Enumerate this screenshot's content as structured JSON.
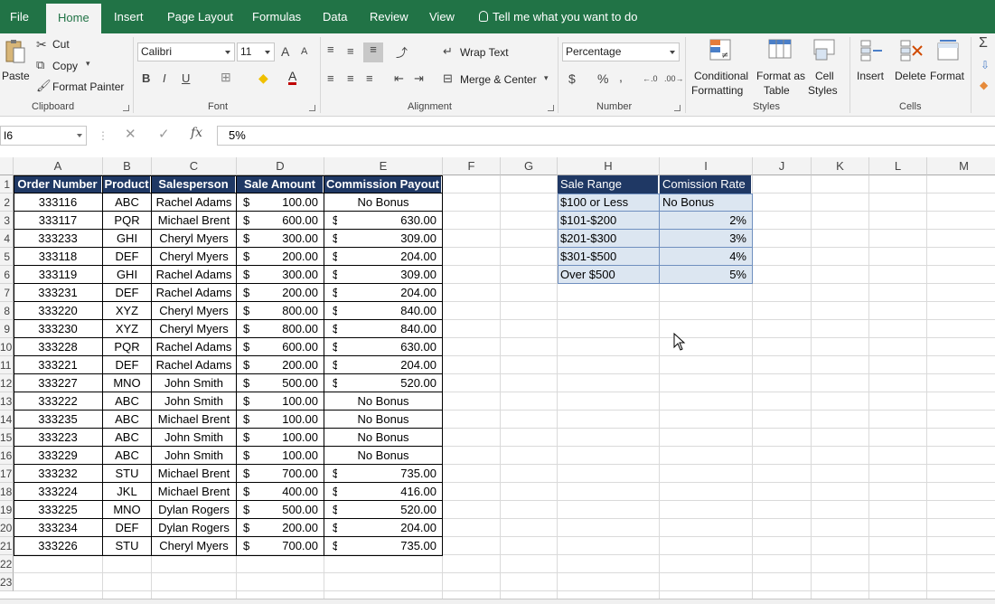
{
  "tabs": [
    {
      "label": "File"
    },
    {
      "label": "Home"
    },
    {
      "label": "Insert"
    },
    {
      "label": "Page Layout"
    },
    {
      "label": "Formulas"
    },
    {
      "label": "Data"
    },
    {
      "label": "Review"
    },
    {
      "label": "View"
    }
  ],
  "tell_me": "Tell me what you want to do",
  "ribbon": {
    "clipboard": {
      "paste": "Paste",
      "cut": "Cut",
      "copy": "Copy",
      "format_painter": "Format Painter",
      "label": "Clipboard"
    },
    "font": {
      "name": "Calibri",
      "size": "11",
      "label": "Font"
    },
    "alignment": {
      "wrap": "Wrap Text",
      "merge": "Merge & Center",
      "label": "Alignment"
    },
    "number": {
      "format": "Percentage",
      "label": "Number"
    },
    "styles": {
      "cond1": "Conditional",
      "cond2": "Formatting",
      "fmt1": "Format as",
      "fmt2": "Table",
      "cell1": "Cell",
      "cell2": "Styles",
      "label": "Styles"
    },
    "cells": {
      "insert": "Insert",
      "delete": "Delete",
      "format": "Format",
      "label": "Cells"
    }
  },
  "formula_bar": {
    "name_box": "I6",
    "formula": "5%"
  },
  "columns": [
    "A",
    "B",
    "C",
    "D",
    "E",
    "F",
    "G",
    "H",
    "I",
    "J",
    "K",
    "L",
    "M"
  ],
  "rows": [
    "1",
    "2",
    "3",
    "4",
    "5",
    "6",
    "7",
    "8",
    "9",
    "10",
    "11",
    "12",
    "13",
    "14",
    "15",
    "16",
    "17",
    "18",
    "19",
    "20",
    "21",
    "22",
    "23"
  ],
  "table_headers": [
    "Order Number",
    "Product",
    "Salesperson",
    "Sale Amount",
    "Commission Payout"
  ],
  "table_rows": [
    [
      "333116",
      "ABC",
      "Rachel Adams",
      "100.00",
      "No Bonus"
    ],
    [
      "333117",
      "PQR",
      "Michael Brent",
      "600.00",
      "630.00"
    ],
    [
      "333233",
      "GHI",
      "Cheryl Myers",
      "300.00",
      "309.00"
    ],
    [
      "333118",
      "DEF",
      "Cheryl Myers",
      "200.00",
      "204.00"
    ],
    [
      "333119",
      "GHI",
      "Rachel Adams",
      "300.00",
      "309.00"
    ],
    [
      "333231",
      "DEF",
      "Rachel Adams",
      "200.00",
      "204.00"
    ],
    [
      "333220",
      "XYZ",
      "Cheryl Myers",
      "800.00",
      "840.00"
    ],
    [
      "333230",
      "XYZ",
      "Cheryl Myers",
      "800.00",
      "840.00"
    ],
    [
      "333228",
      "PQR",
      "Rachel Adams",
      "600.00",
      "630.00"
    ],
    [
      "333221",
      "DEF",
      "Rachel Adams",
      "200.00",
      "204.00"
    ],
    [
      "333227",
      "MNO",
      "John Smith",
      "500.00",
      "520.00"
    ],
    [
      "333222",
      "ABC",
      "John Smith",
      "100.00",
      "No Bonus"
    ],
    [
      "333235",
      "ABC",
      "Michael Brent",
      "100.00",
      "No Bonus"
    ],
    [
      "333223",
      "ABC",
      "John Smith",
      "100.00",
      "No Bonus"
    ],
    [
      "333229",
      "ABC",
      "John Smith",
      "100.00",
      "No Bonus"
    ],
    [
      "333232",
      "STU",
      "Michael Brent",
      "700.00",
      "735.00"
    ],
    [
      "333224",
      "JKL",
      "Michael Brent",
      "400.00",
      "416.00"
    ],
    [
      "333225",
      "MNO",
      "Dylan Rogers",
      "500.00",
      "520.00"
    ],
    [
      "333234",
      "DEF",
      "Dylan Rogers",
      "200.00",
      "204.00"
    ],
    [
      "333226",
      "STU",
      "Cheryl Myers",
      "700.00",
      "735.00"
    ]
  ],
  "currency_symbol": "$",
  "rate_headers": [
    "Sale Range",
    "Comission Rate"
  ],
  "rate_rows": [
    [
      "$100 or Less",
      "No Bonus"
    ],
    [
      "$101-$200",
      "2%"
    ],
    [
      "$201-$300",
      "3%"
    ],
    [
      "$301-$500",
      "4%"
    ],
    [
      "Over $500",
      "5%"
    ]
  ],
  "colors": {
    "excel_green": "#217346",
    "header_navy": "#1f3864",
    "rate_fill": "#dce6f1"
  }
}
